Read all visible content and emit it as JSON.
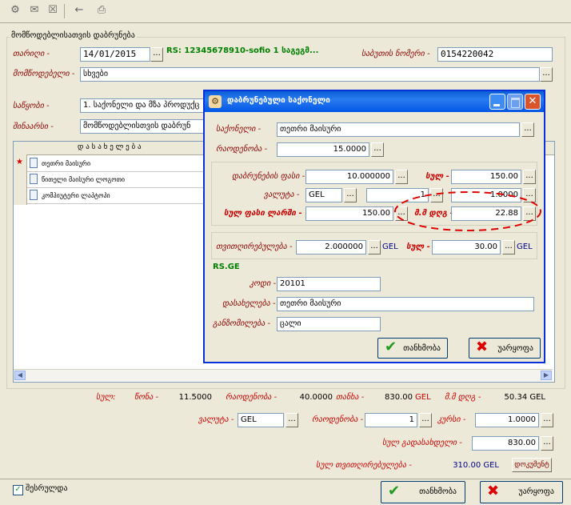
{
  "toolbar": {
    "icons": [
      "grid-settings-icon",
      "open-folder-icon",
      "delete-icon",
      "back-arrow-icon",
      "print-icon"
    ]
  },
  "main": {
    "groupbox_title": "მომწოდებლისათვის დაბრუნება",
    "date_label": "თარიღი -",
    "date_value": "14/01/2015",
    "rs_text": "RS: 12345678910-sofio  1 საგეგმ...",
    "docnum_label": "საბუთის ნომერი -",
    "docnum_value": "0154220042",
    "supplier_label": "მომწოდებელი -",
    "supplier_value": "სხვები",
    "store_label": "საწყობი -",
    "store_value": "1. საქონელი და მზა პროდუქც",
    "note_label": "შინაარსი -",
    "note_value": "მომწოდებლისთვის დაბრუნ",
    "grid_header": "დ ა ს ა ხ ე ლ ე ბ ა",
    "grid_rows": [
      "თეთრი მაისური",
      "წითელი მაისური ლოგოთი",
      "კომპიუტერი ლაპტოპი"
    ]
  },
  "dialog": {
    "title": "დაბრუნებული საქონელი",
    "product_label": "საქონელი -",
    "product_value": "თეთრი მაისური",
    "qty_label": "რაოდენობა -",
    "qty_value": "15.0000",
    "return_price_label": "დაბრუნების ფასი -",
    "return_price_value": "10.000000",
    "sum_label": "სულ -",
    "sum_value": "150.00",
    "currency_label": "ვალუტა -",
    "currency_value": "GEL",
    "rate_value": "1",
    "rate2_value": "1.0000",
    "total_label": "სულ ფასი ლარში -",
    "total_value": "150.00",
    "vat_label": "მ.მ დღგ -",
    "vat_value": "22.88",
    "cost_label": "თვითღირებულება -",
    "cost_value": "2.000000",
    "cost_unit": "GEL",
    "cost_sum_label": "სულ -",
    "cost_sum_value": "30.00",
    "cost_sum_unit": "GEL",
    "rsge_label": "RS.GE",
    "code_label": "კოდი -",
    "code_value": "20101",
    "name_label": "დასახელება -",
    "name_value": "თეთრი მაისური",
    "unit_label": "განზომილება -",
    "unit_value": "ცალი",
    "ok_label": "თანხმობა",
    "cancel_label": "უარყოფა"
  },
  "totals": {
    "sum_label": "სულ:",
    "weight_label": "წონა -",
    "weight_value": "11.5000",
    "qty_label": "რაოდენობა -",
    "qty_value": "40.0000",
    "amount_label": "თანხა -",
    "amount_value": "830.00",
    "amount_unit": "GEL",
    "vat_label": "მ.მ დღგ -",
    "vat_value": "50.34 GEL",
    "currency_label": "ვალუტა -",
    "currency_value": "GEL",
    "qty2_label": "რაოდენობა -",
    "qty2_value": "1",
    "rate_label": "კურსი -",
    "rate_value": "1.0000",
    "payable_label": "სულ გადასახდელი -",
    "payable_value": "830.00",
    "cost_label": "სულ თვითღირებულება -",
    "cost_value": "310.00 GEL",
    "conduct_label": "დოკუმენტ"
  },
  "footer": {
    "done_label": "შესრულდა",
    "ok_label": "თანხმობა",
    "cancel_label": "უარყოფა"
  },
  "colors": {
    "accent_red": "#cc0000",
    "label_dark_red": "#8b0000",
    "rs_green": "#008000",
    "title_blue": "#0a246a"
  }
}
